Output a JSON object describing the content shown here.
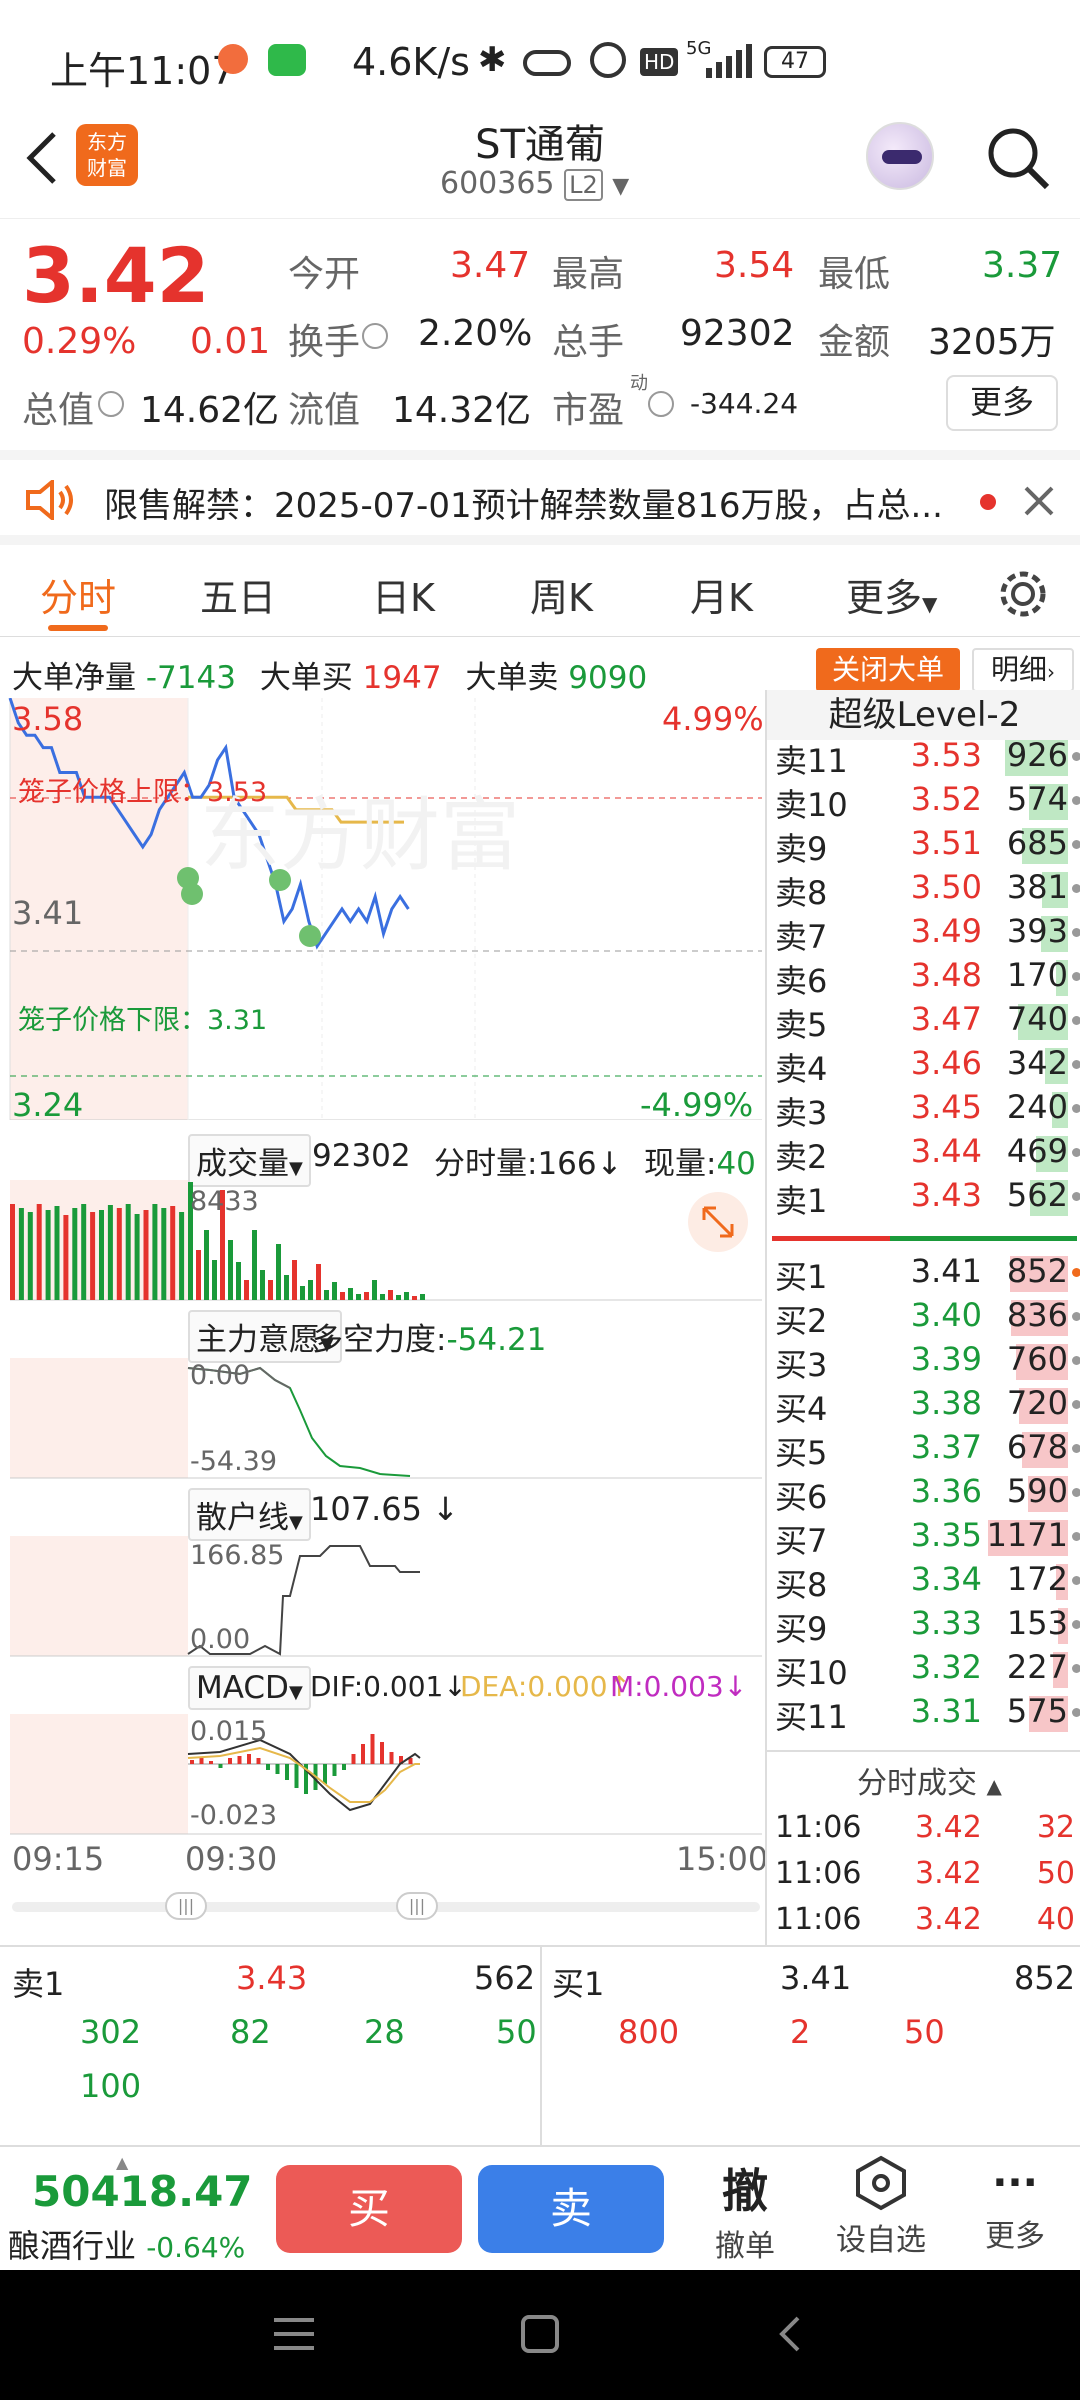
{
  "status": {
    "time": "上午11:07",
    "speed": "4.6K/s",
    "signal": "5G",
    "battery": "47"
  },
  "header": {
    "title": "ST通葡",
    "code": "600365",
    "level": "L2",
    "logo_line1": "东方",
    "logo_line2": "财富"
  },
  "quote": {
    "price": "3.42",
    "pct": "0.29%",
    "chg": "0.01",
    "open_label": "今开",
    "open": "3.47",
    "high_label": "最高",
    "high": "3.54",
    "low_label": "最低",
    "low": "3.37",
    "turnover_label": "换手",
    "turnover": "2.20%",
    "volume_label": "总手",
    "volume": "92302",
    "amount_label": "金额",
    "amount": "3205万",
    "mktcap_label": "总值",
    "mktcap": "14.62亿",
    "float_label": "流值",
    "float": "14.32亿",
    "pe_label": "市盈",
    "pe_sup": "动",
    "pe": "-344.24",
    "more": "更多"
  },
  "notice": {
    "text": "限售解禁：2025-07-01预计解禁数量816万股，占总..."
  },
  "tabs": [
    "分时",
    "五日",
    "日K",
    "周K",
    "月K",
    "更多"
  ],
  "bigorder": {
    "net_label": "大单净量",
    "net": "-7143",
    "buy_label": "大单买",
    "buy": "1947",
    "sell_label": "大单卖",
    "sell": "9090",
    "close_btn": "关闭大单",
    "detail_btn": "明细"
  },
  "chart": {
    "top_price": "3.58",
    "top_pct": "4.99%",
    "mid_price": "3.41",
    "bottom_price": "3.24",
    "bottom_pct": "-4.99%",
    "cage_upper": "笼子价格上限：3.53",
    "cage_lower": "笼子价格下限：3.31",
    "watermark": "东方财富",
    "price_series": [
      3.58,
      3.56,
      3.55,
      3.55,
      3.54,
      3.54,
      3.52,
      3.52,
      3.52,
      3.5,
      3.5,
      3.5,
      3.5,
      3.49,
      3.48,
      3.47,
      3.46,
      3.47,
      3.49,
      3.5,
      3.51,
      3.52,
      3.5,
      3.5,
      3.51,
      3.53,
      3.54,
      3.5,
      3.49,
      3.48,
      3.47,
      3.45,
      3.43,
      3.4,
      3.41,
      3.43,
      3.4,
      3.38,
      3.39,
      3.4,
      3.41,
      3.4,
      3.41,
      3.4,
      3.42,
      3.39,
      3.41,
      3.42,
      3.41
    ],
    "avg_series": [
      3.5,
      3.5,
      3.5,
      3.5,
      3.5,
      3.5,
      3.5,
      3.5,
      3.5,
      3.5,
      3.5,
      3.5,
      3.49,
      3.49,
      3.49,
      3.49,
      3.49,
      3.48,
      3.48,
      3.48,
      3.48,
      3.48,
      3.48,
      3.48,
      3.48
    ],
    "time_start": "09:15",
    "time_mid": "09:30",
    "time_end": "15:00"
  },
  "volume": {
    "label": "成交量",
    "value": "92302",
    "fs_label": "分时量:166",
    "arrow": "↓",
    "now_label": "现量:",
    "now": "40",
    "max": "8433"
  },
  "zhuli": {
    "label": "主力意愿",
    "dk_label": "多空力度:",
    "dk": "-54.21",
    "top": "0.00",
    "bottom": "-54.39"
  },
  "sanhu": {
    "label": "散户线",
    "value": "107.65",
    "arrow": "↓",
    "top": "166.85",
    "bottom": "0.00"
  },
  "macd": {
    "label": "MACD",
    "dif": "DIF:0.001",
    "dea": "DEA:0.000",
    "m": "M:0.003",
    "top": "0.015",
    "bottom": "-0.023"
  },
  "orderbook": {
    "title": "超级Level-2",
    "asks": [
      {
        "l": "卖11",
        "p": "3.53",
        "v": "926",
        "w": 0.79
      },
      {
        "l": "卖10",
        "p": "3.52",
        "v": "574",
        "w": 0.49
      },
      {
        "l": "卖9",
        "p": "3.51",
        "v": "685",
        "w": 0.58
      },
      {
        "l": "卖8",
        "p": "3.50",
        "v": "381",
        "w": 0.33
      },
      {
        "l": "卖7",
        "p": "3.49",
        "v": "393",
        "w": 0.34
      },
      {
        "l": "卖6",
        "p": "3.48",
        "v": "170",
        "w": 0.15
      },
      {
        "l": "卖5",
        "p": "3.47",
        "v": "740",
        "w": 0.63
      },
      {
        "l": "卖4",
        "p": "3.46",
        "v": "342",
        "w": 0.29
      },
      {
        "l": "卖3",
        "p": "3.45",
        "v": "240",
        "w": 0.2
      },
      {
        "l": "卖2",
        "p": "3.44",
        "v": "469",
        "w": 0.4
      },
      {
        "l": "卖1",
        "p": "3.43",
        "v": "562",
        "w": 0.48
      }
    ],
    "bids": [
      {
        "l": "买1",
        "p": "3.41",
        "v": "852",
        "w": 0.73
      },
      {
        "l": "买2",
        "p": "3.40",
        "v": "836",
        "w": 0.71
      },
      {
        "l": "买3",
        "p": "3.39",
        "v": "760",
        "w": 0.65
      },
      {
        "l": "买4",
        "p": "3.38",
        "v": "720",
        "w": 0.61
      },
      {
        "l": "买5",
        "p": "3.37",
        "v": "678",
        "w": 0.58
      },
      {
        "l": "买6",
        "p": "3.36",
        "v": "590",
        "w": 0.5
      },
      {
        "l": "买7",
        "p": "3.35",
        "v": "1171",
        "w": 1.0
      },
      {
        "l": "买8",
        "p": "3.34",
        "v": "172",
        "w": 0.15
      },
      {
        "l": "买9",
        "p": "3.33",
        "v": "153",
        "w": 0.13
      },
      {
        "l": "买10",
        "p": "3.32",
        "v": "227",
        "w": 0.19
      },
      {
        "l": "买11",
        "p": "3.31",
        "v": "575",
        "w": 0.49
      }
    ],
    "trades_title": "分时成交",
    "trades": [
      {
        "t": "11:06",
        "p": "3.42",
        "v": "32"
      },
      {
        "t": "11:06",
        "p": "3.42",
        "v": "50"
      },
      {
        "t": "11:06",
        "p": "3.42",
        "v": "40"
      }
    ]
  },
  "queue": {
    "sell_label": "卖1",
    "sell_price": "3.43",
    "sell_vol": "562",
    "sell_orders": [
      "302",
      "82",
      "28",
      "50",
      "100"
    ],
    "buy_label": "买1",
    "buy_price": "3.41",
    "buy_vol": "852",
    "buy_orders": [
      "800",
      "2",
      "50"
    ]
  },
  "bottom": {
    "index_value": "50418.47",
    "industry": "酿酒行业",
    "industry_pct": "-0.64%",
    "buy": "买",
    "sell": "卖",
    "cancel_icon": "撤",
    "cancel": "撤单",
    "watch": "设自选",
    "more": "更多"
  },
  "colors": {
    "red": "#e5332d",
    "green": "#1a9a3a",
    "orange": "#f06a1c",
    "blue": "#3a6fe0"
  }
}
